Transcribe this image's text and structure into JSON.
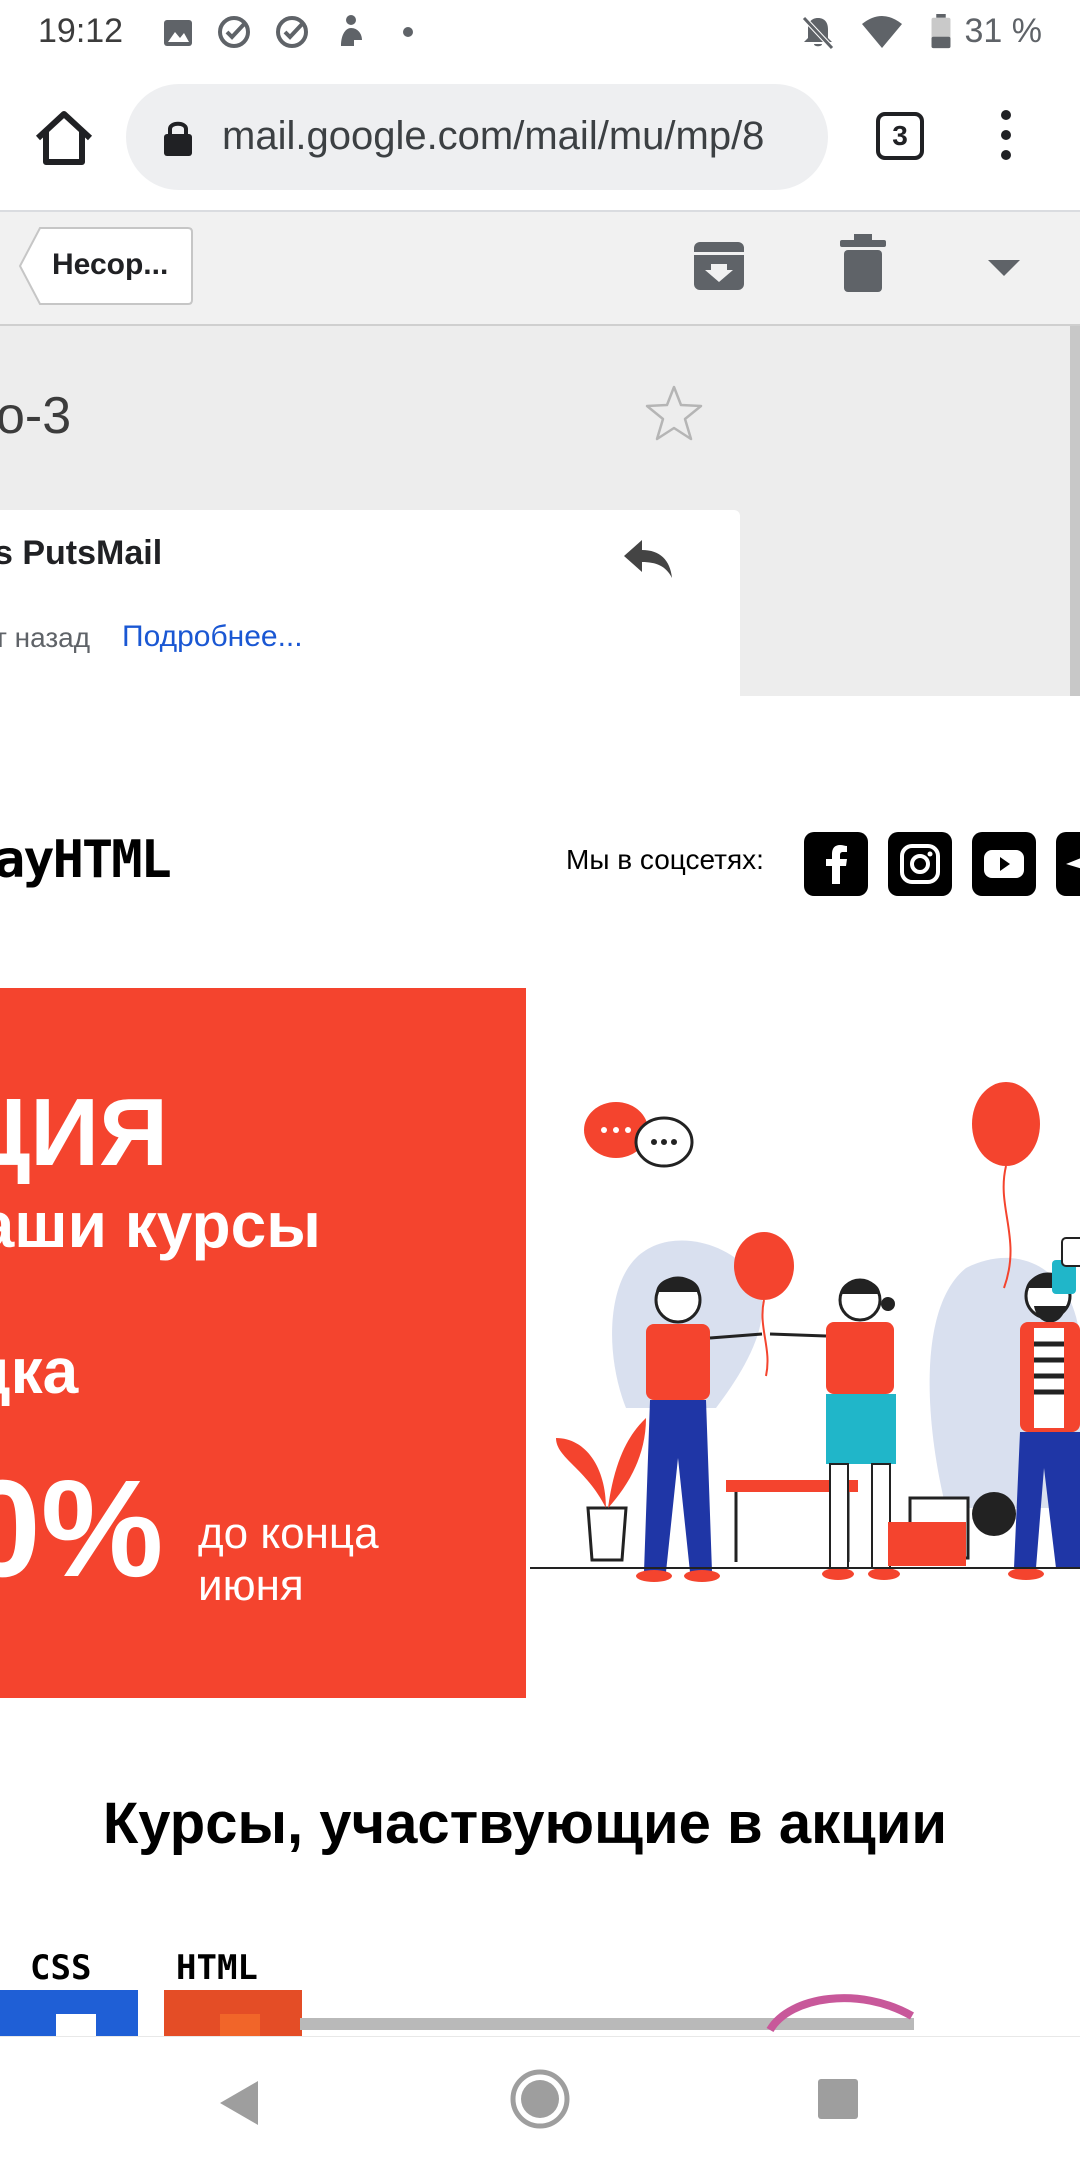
{
  "status_bar": {
    "time": "19:12",
    "battery": "31 %"
  },
  "browser": {
    "url": "mail.google.com/mail/mu/mp/8",
    "tab_count": "3"
  },
  "toolbar": {
    "back_label": "Несор..."
  },
  "email": {
    "subject": "о-3",
    "sender": "s PutsMail",
    "sent_time": "т назад",
    "details_link": "Подробнее..."
  },
  "newsletter": {
    "logo": "ayHTML",
    "social_label": "Мы в соцсетях:",
    "social_icons": [
      "facebook-icon",
      "instagram-icon",
      "youtube-icon",
      "telegram-icon"
    ],
    "promo": {
      "title": "ЦИЯ",
      "subtitle": "наши курсы",
      "discount_word": "дка",
      "percent": "0%",
      "until_line1": "до конца",
      "until_line2": "июня",
      "color": "#f4442e"
    },
    "courses_title": "Курсы, участвующие в акции",
    "courses": [
      {
        "label": "CSS"
      },
      {
        "label": "HTML"
      }
    ]
  },
  "colors": {
    "link": "#1a57d3",
    "promo_red": "#f4442e"
  }
}
